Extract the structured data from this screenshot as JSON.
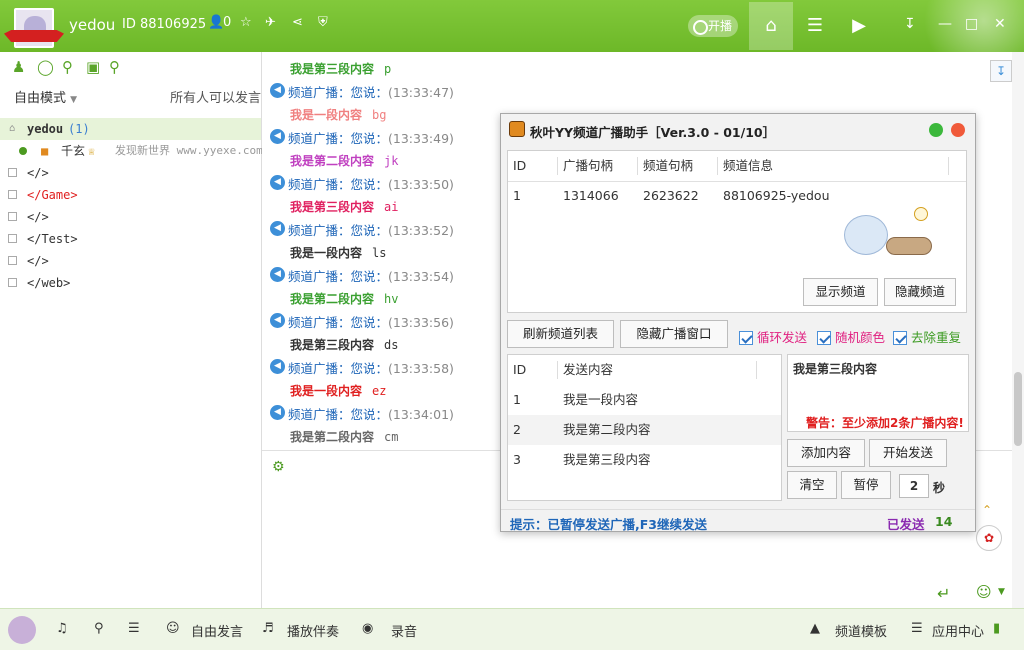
{
  "header": {
    "username": "yedou",
    "user_id": "ID 88106925",
    "fans_count": "0",
    "live_label": "开播"
  },
  "left": {
    "mode_label": "自由模式",
    "speak_rule": "所有人可以发言",
    "channel_root": "yedou",
    "channel_root_count": "(1)",
    "member_name": "千玄",
    "member_note": "发现新世界 www.yyexe.com",
    "subchannels": [
      "</>",
      "</Game>",
      "</>",
      "</Test>",
      "</>",
      "</web>"
    ]
  },
  "chat": {
    "broadcast_prefix": "频道广播：您说：",
    "messages": [
      {
        "header": "我是第三段内容",
        "key": "p",
        "time": "(13:33:47)",
        "color": "#3aa030"
      },
      {
        "header": "我是一段内容",
        "key": "bg",
        "time": "(13:33:49)",
        "color": "#f08080"
      },
      {
        "header": "我是第二段内容",
        "key": "jk",
        "time": "(13:33:50)",
        "color": "#c040c0"
      },
      {
        "header": "我是第三段内容",
        "key": "ai",
        "time": "(13:33:52)",
        "color": "#e02060"
      },
      {
        "header": "我是一段内容",
        "key": "ls",
        "time": "(13:33:54)",
        "color": "#333333"
      },
      {
        "header": "我是第二段内容",
        "key": "hv",
        "time": "(13:33:56)",
        "color": "#3aa030"
      },
      {
        "header": "我是第三段内容",
        "key": "ds",
        "time": "(13:33:58)",
        "color": "#333333"
      },
      {
        "header": "我是一段内容",
        "key": "ez",
        "time": "(13:34:01)",
        "color": "#e02020"
      },
      {
        "header": "我是第二段内容",
        "key": "cm",
        "time": "",
        "color": "#666666"
      }
    ]
  },
  "dialog": {
    "title": "秋叶YY频道广播助手［Ver.3.0 - 01/10］",
    "channel_table": {
      "headers": [
        "ID",
        "广播句柄",
        "频道句柄",
        "频道信息"
      ],
      "rows": [
        [
          "1",
          "1314066",
          "2623622",
          "88106925-yedou"
        ]
      ]
    },
    "show_channel_btn": "显示频道",
    "hide_channel_btn": "隐藏频道",
    "refresh_btn": "刷新频道列表",
    "hide_broadcast_btn": "隐藏广播窗口",
    "check_loop": "循环发送",
    "check_random_color": "随机颜色",
    "check_dedupe": "去除重复",
    "content_table": {
      "headers": [
        "ID",
        "发送内容"
      ],
      "rows": [
        [
          "1",
          "我是一段内容"
        ],
        [
          "2",
          "我是第二段内容"
        ],
        [
          "3",
          "我是第三段内容"
        ]
      ]
    },
    "preview_text": "我是第三段内容",
    "warning": "警告：至少添加2条广播内容!",
    "add_btn": "添加内容",
    "start_btn": "开始发送",
    "clear_btn": "清空",
    "pause_btn": "暂停",
    "interval_value": "2",
    "interval_unit": "秒",
    "hint": "提示：已暂停发送广播,F3继续发送",
    "sent_label": "已发送",
    "sent_count": "14"
  },
  "bottom": {
    "free_speak": "自由发言",
    "accompany": "播放伴奏",
    "record": "录音",
    "channel_template": "频道模板",
    "app_center": "应用中心"
  },
  "colors": {
    "brand_green": "#6db828",
    "link_blue": "#1f66b8",
    "warn_red": "#e02020"
  }
}
